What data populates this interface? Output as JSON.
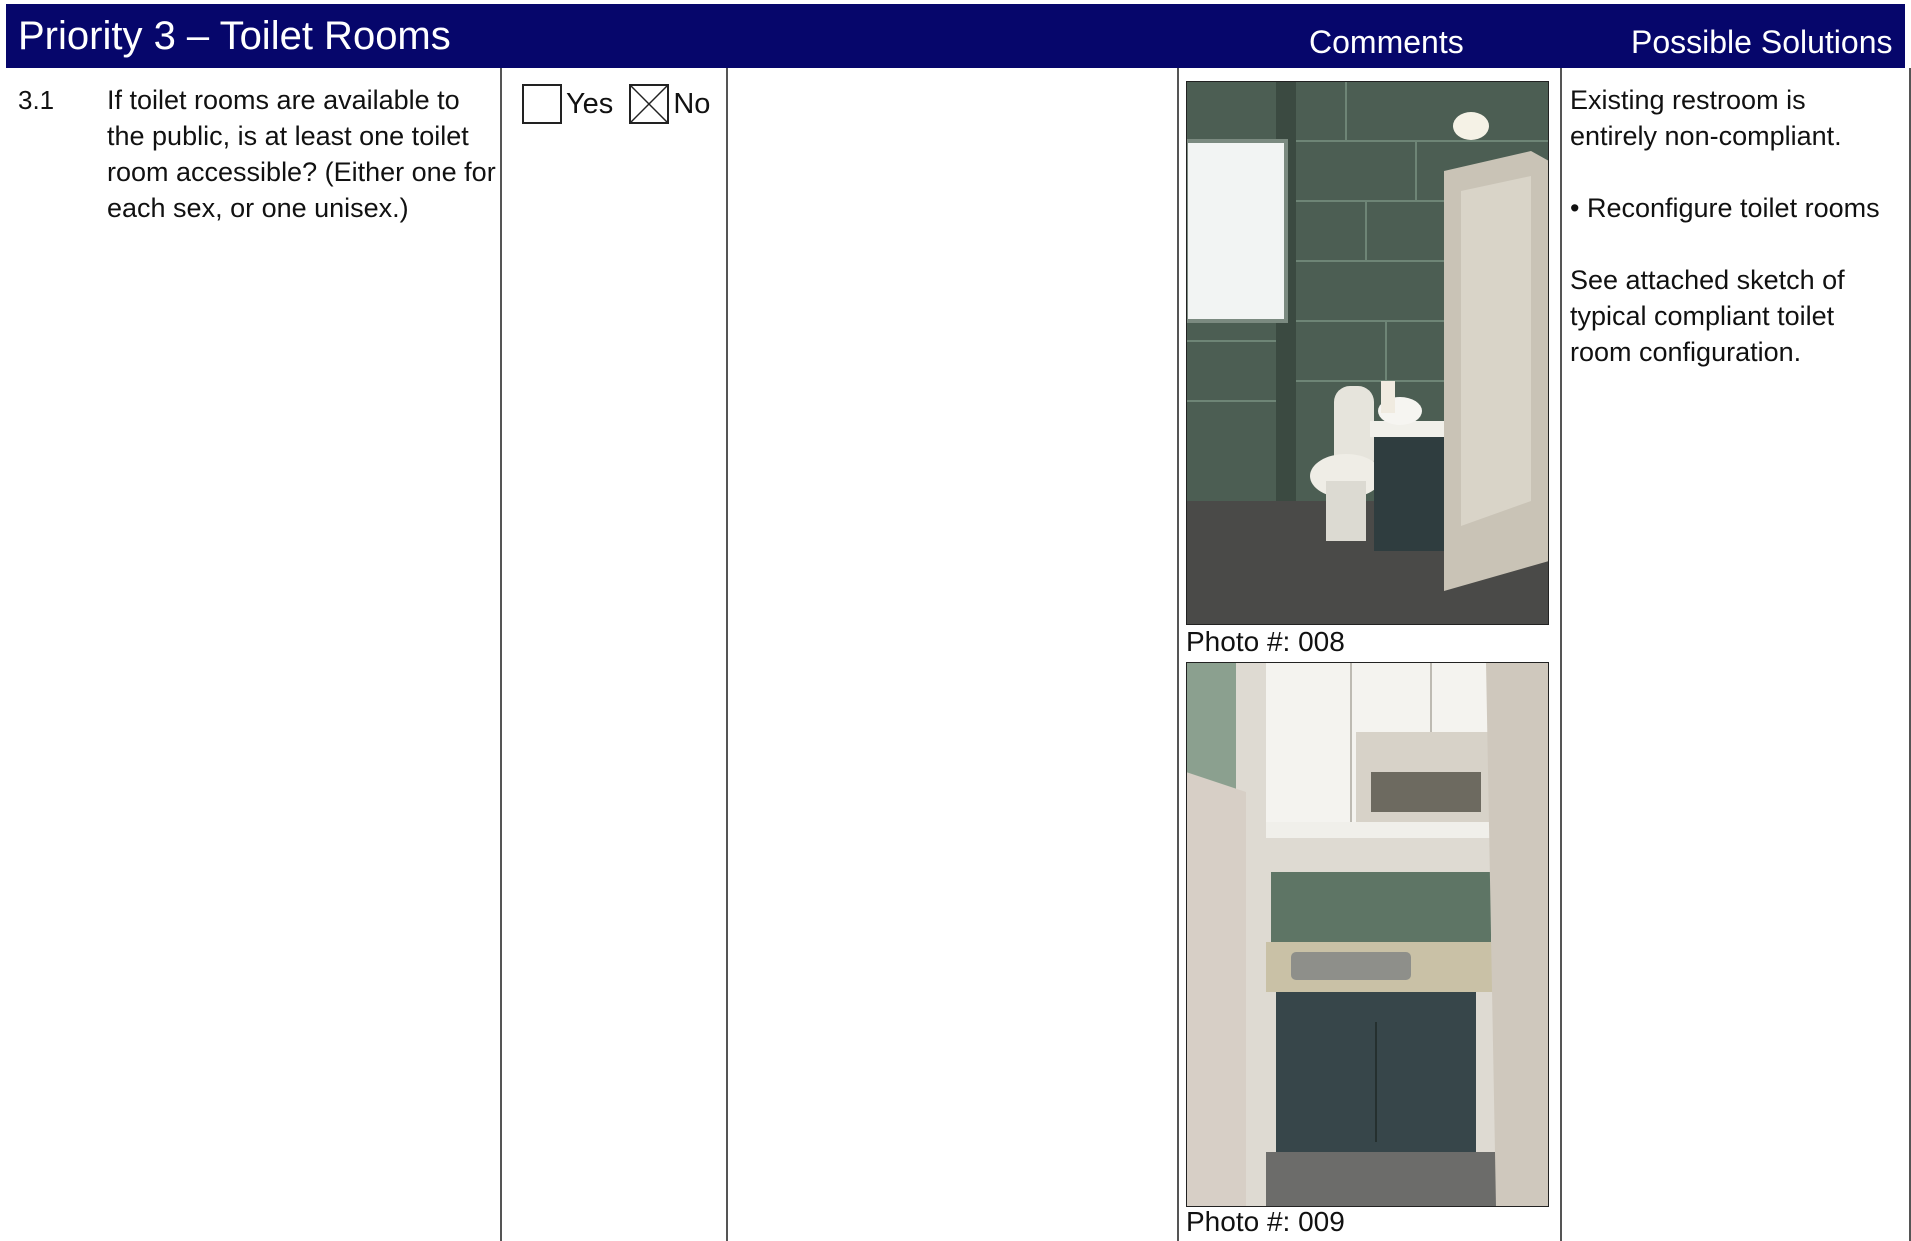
{
  "header": {
    "title": "Priority 3 – Toilet Rooms",
    "comments_label": "Comments",
    "solutions_label": "Possible Solutions",
    "bg_color": "#06066b"
  },
  "item": {
    "number": "3.1",
    "question": "If toilet rooms are available to the public, is at least one toilet room accessible? (Either one for each sex, or one unisex.)",
    "answer": {
      "yes_label": "Yes",
      "no_label": "No",
      "yes_checked": false,
      "no_checked": true
    }
  },
  "photos": [
    {
      "caption": "Photo #:  008"
    },
    {
      "caption": "Photo #:  009"
    }
  ],
  "solutions": {
    "line1": "Existing restroom is entirely non-compliant.",
    "line2": "• Reconfigure toilet rooms",
    "line3": "See attached sketch of typical compliant toilet room configuration."
  }
}
